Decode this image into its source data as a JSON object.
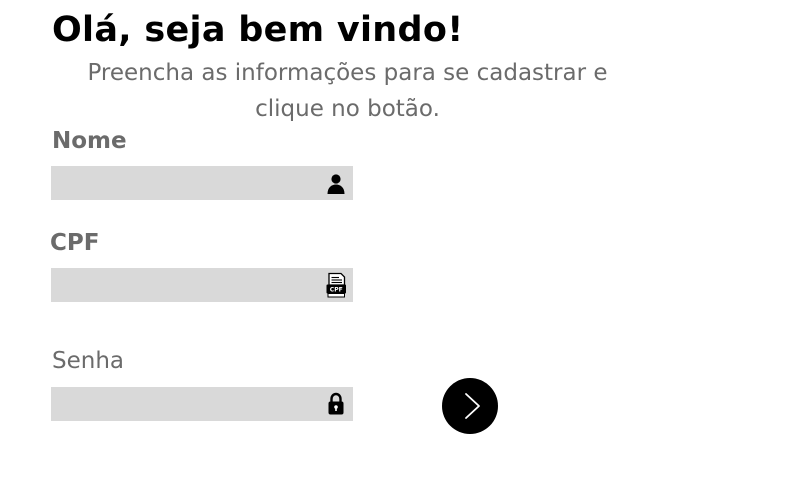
{
  "header": {
    "title": "Olá, seja bem vindo!",
    "subtitle": "Preencha as informações para se cadastrar e clique no botão."
  },
  "form": {
    "nome": {
      "label": "Nome",
      "value": "",
      "icon": "user-icon"
    },
    "cpf": {
      "label": "CPF",
      "value": "",
      "icon": "cpf-document-icon",
      "icon_text": "CPF"
    },
    "senha": {
      "label": "Senha",
      "value": "",
      "icon": "lock-icon"
    },
    "submit": {
      "icon": "chevron-right-icon"
    }
  },
  "colors": {
    "title": "#000000",
    "text_muted": "#6b6b6b",
    "field_bg": "#d9d9d9",
    "button_bg": "#000000",
    "button_icon": "#ffffff"
  }
}
